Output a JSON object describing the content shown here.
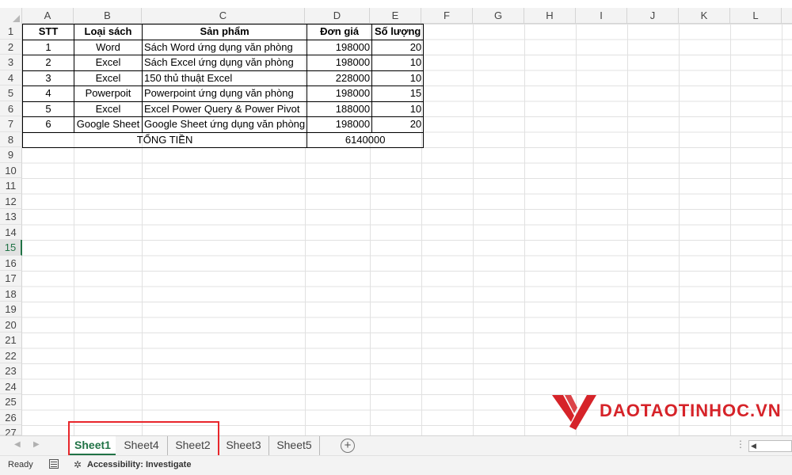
{
  "columns": [
    "A",
    "B",
    "C",
    "D",
    "E",
    "F",
    "G",
    "H",
    "I",
    "J",
    "K",
    "L"
  ],
  "rows": [
    "1",
    "2",
    "3",
    "4",
    "5",
    "6",
    "7",
    "8",
    "9",
    "10",
    "11",
    "12",
    "13",
    "14",
    "15",
    "16",
    "17",
    "18",
    "19",
    "20",
    "21",
    "22",
    "23",
    "24",
    "25",
    "26",
    "27"
  ],
  "active_row": "15",
  "table": {
    "headers": [
      "STT",
      "Loại sách",
      "Sản phẩm",
      "Đơn giá",
      "Số lượng"
    ],
    "rows": [
      [
        "1",
        "Word",
        "Sách Word ứng dụng văn phòng",
        "198000",
        "20"
      ],
      [
        "2",
        "Excel",
        "Sách Excel ứng dụng văn phòng",
        "198000",
        "10"
      ],
      [
        "3",
        "Excel",
        "150 thủ thuật Excel",
        "228000",
        "10"
      ],
      [
        "4",
        "Powerpoit",
        "Powerpoint ứng dụng văn phòng",
        "198000",
        "15"
      ],
      [
        "5",
        "Excel",
        "Excel Power Query & Power Pivot",
        "188000",
        "10"
      ],
      [
        "6",
        "Google Sheet",
        "Google Sheet ứng dụng văn phòng",
        "198000",
        "20"
      ]
    ],
    "total_label": "TỔNG TIỀN",
    "total_value": "6140000"
  },
  "watermark": {
    "text": "DAOTAOTINHOC.VN",
    "color": "#d62329"
  },
  "sheet_tabs": {
    "active": "Sheet1",
    "tabs": [
      "Sheet1",
      "Sheet4",
      "Sheet2",
      "Sheet3",
      "Sheet5"
    ],
    "add_icon": "plus-circle-icon"
  },
  "status_bar": {
    "ready": "Ready",
    "accessibility": "Accessibility: Investigate"
  },
  "colors": {
    "accent": "#217346",
    "highlight": "#e8262b"
  }
}
